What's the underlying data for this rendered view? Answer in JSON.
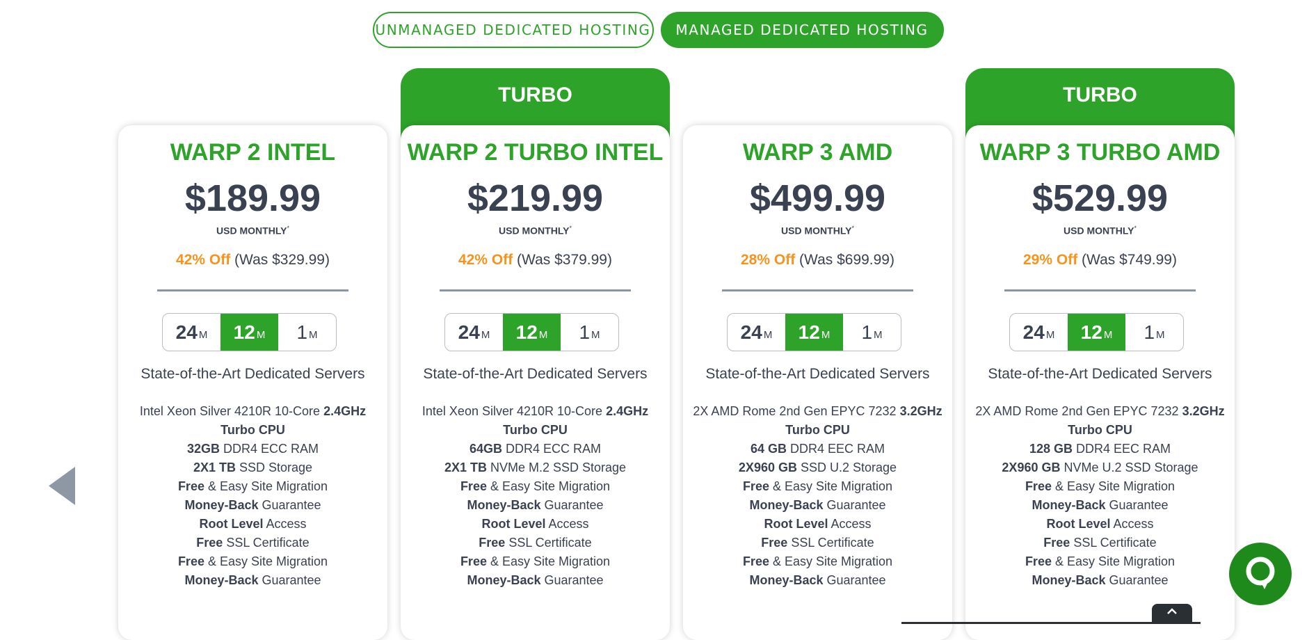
{
  "tabs": {
    "unmanaged": "UNMANAGED DEDICATED HOSTING",
    "managed": "MANAGED DEDICATED HOSTING"
  },
  "colors": {
    "brand_green": "#2ea32a",
    "discount_orange": "#f5941d",
    "text_dark": "#3a4150"
  },
  "plans": [
    {
      "banner": "",
      "name": "WARP 2 INTEL",
      "price": "$189.99",
      "period": "USD MONTHLY",
      "asterisk": "*",
      "discount_off": "42% Off",
      "discount_was": "(Was $329.99)",
      "terms": [
        {
          "num": "24",
          "unit": "M"
        },
        {
          "num": "12",
          "unit": "M"
        },
        {
          "num": "1",
          "unit": "M"
        }
      ],
      "active_term": "12",
      "tagline": "State-of-the-Art Dedicated Servers",
      "features": [
        {
          "pre": "Intel Xeon Silver 4210R 10-Core ",
          "bold": "2.4GHz",
          "post": ""
        },
        {
          "pre": "",
          "bold": "Turbo CPU",
          "post": ""
        },
        {
          "pre": "",
          "bold": "32GB",
          "post": " DDR4 ECC RAM"
        },
        {
          "pre": "",
          "bold": "2X1 TB",
          "post": " SSD Storage"
        },
        {
          "pre": "",
          "bold": "Free",
          "post": " & Easy Site Migration"
        },
        {
          "pre": "",
          "bold": "Money-Back",
          "post": " Guarantee"
        },
        {
          "pre": "",
          "bold": "Root Level",
          "post": " Access"
        },
        {
          "pre": "",
          "bold": "Free",
          "post": " SSL Certificate"
        },
        {
          "pre": "",
          "bold": "Free",
          "post": " & Easy Site Migration"
        },
        {
          "pre": "",
          "bold": "Money-Back",
          "post": " Guarantee"
        }
      ]
    },
    {
      "banner": "TURBO",
      "name": "WARP 2 TURBO INTEL",
      "price": "$219.99",
      "period": "USD MONTHLY",
      "asterisk": "*",
      "discount_off": "42% Off",
      "discount_was": "(Was $379.99)",
      "terms": [
        {
          "num": "24",
          "unit": "M"
        },
        {
          "num": "12",
          "unit": "M"
        },
        {
          "num": "1",
          "unit": "M"
        }
      ],
      "active_term": "12",
      "tagline": "State-of-the-Art Dedicated Servers",
      "features": [
        {
          "pre": "Intel Xeon Silver 4210R 10-Core ",
          "bold": "2.4GHz",
          "post": ""
        },
        {
          "pre": "",
          "bold": "Turbo CPU",
          "post": ""
        },
        {
          "pre": "",
          "bold": "64GB",
          "post": " DDR4 ECC RAM"
        },
        {
          "pre": "",
          "bold": "2X1 TB",
          "post": " NVMe M.2 SSD Storage"
        },
        {
          "pre": "",
          "bold": "Free",
          "post": " & Easy Site Migration"
        },
        {
          "pre": "",
          "bold": "Money-Back",
          "post": " Guarantee"
        },
        {
          "pre": "",
          "bold": "Root Level",
          "post": " Access"
        },
        {
          "pre": "",
          "bold": "Free",
          "post": " SSL Certificate"
        },
        {
          "pre": "",
          "bold": "Free",
          "post": " & Easy Site Migration"
        },
        {
          "pre": "",
          "bold": "Money-Back",
          "post": " Guarantee"
        }
      ]
    },
    {
      "banner": "",
      "name": "WARP 3 AMD",
      "price": "$499.99",
      "period": "USD MONTHLY",
      "asterisk": "*",
      "discount_off": "28% Off",
      "discount_was": "(Was $699.99)",
      "terms": [
        {
          "num": "24",
          "unit": "M"
        },
        {
          "num": "12",
          "unit": "M"
        },
        {
          "num": "1",
          "unit": "M"
        }
      ],
      "active_term": "12",
      "tagline": "State-of-the-Art Dedicated Servers",
      "features": [
        {
          "pre": "2X AMD Rome 2nd Gen EPYC 7232 ",
          "bold": "3.2GHz",
          "post": ""
        },
        {
          "pre": "",
          "bold": "Turbo CPU",
          "post": ""
        },
        {
          "pre": "",
          "bold": "64 GB",
          "post": " DDR4 EEC RAM"
        },
        {
          "pre": "",
          "bold": "2X960 GB",
          "post": " SSD U.2 Storage"
        },
        {
          "pre": "",
          "bold": "Free",
          "post": " & Easy Site Migration"
        },
        {
          "pre": "",
          "bold": "Money-Back",
          "post": " Guarantee"
        },
        {
          "pre": "",
          "bold": "Root Level",
          "post": " Access"
        },
        {
          "pre": "",
          "bold": "Free",
          "post": " SSL Certificate"
        },
        {
          "pre": "",
          "bold": "Free",
          "post": " & Easy Site Migration"
        },
        {
          "pre": "",
          "bold": "Money-Back",
          "post": " Guarantee"
        }
      ]
    },
    {
      "banner": "TURBO",
      "name": "WARP 3 TURBO AMD",
      "price": "$529.99",
      "period": "USD MONTHLY",
      "asterisk": "*",
      "discount_off": "29% Off",
      "discount_was": "(Was $749.99)",
      "terms": [
        {
          "num": "24",
          "unit": "M"
        },
        {
          "num": "12",
          "unit": "M"
        },
        {
          "num": "1",
          "unit": "M"
        }
      ],
      "active_term": "12",
      "tagline": "State-of-the-Art Dedicated Servers",
      "features": [
        {
          "pre": "2X AMD Rome 2nd Gen EPYC 7232 ",
          "bold": "3.2GHz",
          "post": ""
        },
        {
          "pre": "",
          "bold": "Turbo CPU",
          "post": ""
        },
        {
          "pre": "",
          "bold": "128 GB",
          "post": " DDR4 EEC RAM"
        },
        {
          "pre": "",
          "bold": "2X960 GB",
          "post": " NVMe U.2 SSD Storage"
        },
        {
          "pre": "",
          "bold": "Free",
          "post": " & Easy Site Migration"
        },
        {
          "pre": "",
          "bold": "Money-Back",
          "post": " Guarantee"
        },
        {
          "pre": "",
          "bold": "Root Level",
          "post": " Access"
        },
        {
          "pre": "",
          "bold": "Free",
          "post": " SSL Certificate"
        },
        {
          "pre": "",
          "bold": "Free",
          "post": " & Easy Site Migration"
        },
        {
          "pre": "",
          "bold": "Money-Back",
          "post": " Guarantee"
        }
      ]
    }
  ],
  "icons": {
    "prev": "triangle-left-icon",
    "chat": "chat-bubble-icon",
    "scroll_top": "chevron-up-icon"
  }
}
